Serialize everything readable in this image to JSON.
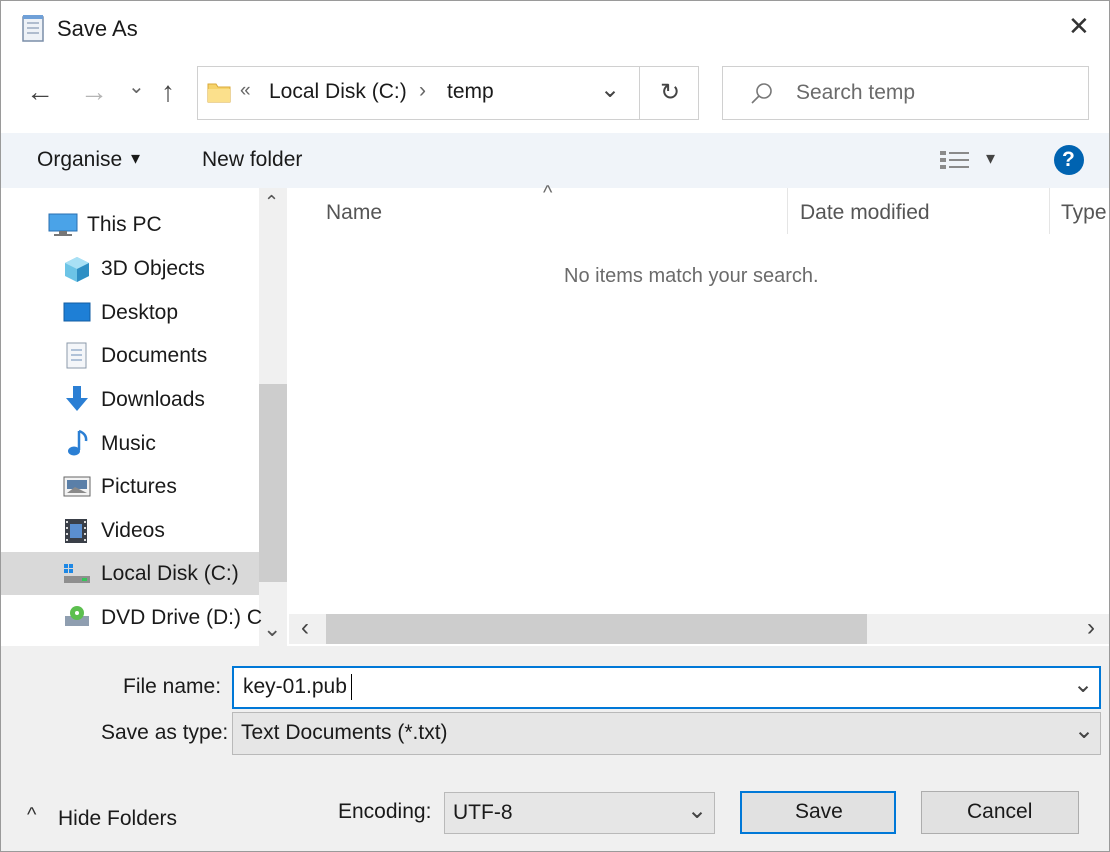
{
  "window": {
    "title": "Save As",
    "close_glyph": "✕"
  },
  "nav": {
    "back_glyph": "←",
    "forward_glyph": "→",
    "recent_glyph": "⌄",
    "up_glyph": "↑",
    "path_prefix": "«",
    "path": [
      "Local Disk (C:)",
      "temp"
    ],
    "path_separator": "›",
    "dropdown_glyph": "⌄",
    "refresh_glyph": "↻",
    "search_placeholder": "Search temp"
  },
  "toolbar": {
    "organise_label": "Organise",
    "organise_caret": "▾",
    "new_folder_label": "New folder",
    "view_caret": "▾",
    "help_glyph": "?"
  },
  "sidebar": {
    "scroll_up_glyph": "⌃",
    "scroll_down_glyph": "⌄",
    "items": [
      {
        "label": "This PC",
        "icon": "computer-icon"
      },
      {
        "label": "3D Objects",
        "icon": "3d-objects-icon"
      },
      {
        "label": "Desktop",
        "icon": "desktop-icon"
      },
      {
        "label": "Documents",
        "icon": "documents-icon"
      },
      {
        "label": "Downloads",
        "icon": "downloads-icon"
      },
      {
        "label": "Music",
        "icon": "music-icon"
      },
      {
        "label": "Pictures",
        "icon": "pictures-icon"
      },
      {
        "label": "Videos",
        "icon": "videos-icon"
      },
      {
        "label": "Local Disk (C:)",
        "icon": "local-disk-icon",
        "selected": true
      },
      {
        "label": "DVD Drive (D:) C",
        "icon": "dvd-drive-icon"
      }
    ]
  },
  "file_list": {
    "sort_glyph": "^",
    "columns": [
      "Name",
      "Date modified",
      "Type"
    ],
    "empty_message": "No items match your search.",
    "hscroll_left_glyph": "‹",
    "hscroll_right_glyph": "›"
  },
  "form": {
    "file_name_label": "File name:",
    "file_name_value": "key-01.pub",
    "save_as_type_label": "Save as type:",
    "save_as_type_value": "Text Documents (*.txt)",
    "dropdown_glyph": "⌄",
    "encoding_label": "Encoding:",
    "encoding_value": "UTF-8"
  },
  "footer": {
    "hide_folders_glyph": "^",
    "hide_folders_label": "Hide Folders",
    "save_label": "Save",
    "cancel_label": "Cancel"
  },
  "colors": {
    "accent": "#0063b1",
    "selection": "#d9d9d9",
    "command_bar": "#f0f4f9",
    "bottom_panel": "#f0f0f0"
  }
}
